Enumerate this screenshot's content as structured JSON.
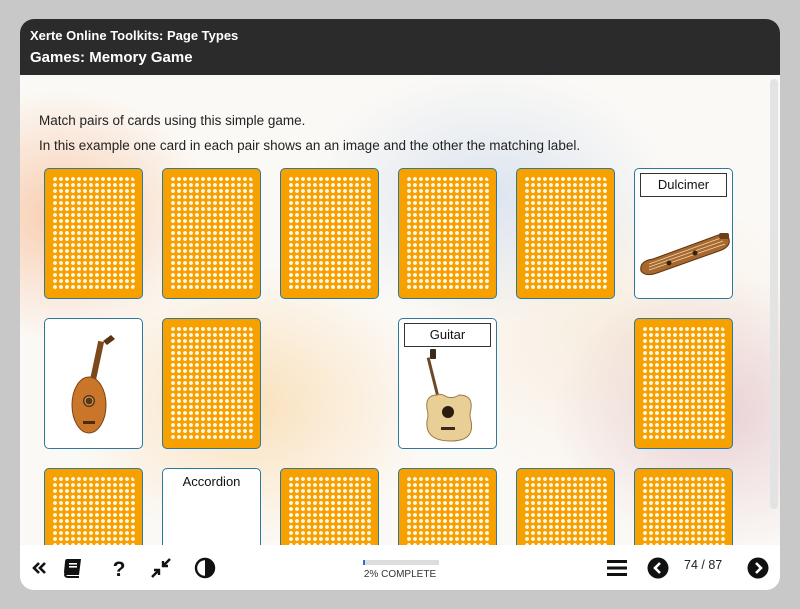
{
  "header": {
    "toolkit_title": "Xerte Online Toolkits: Page Types",
    "page_title": "Games: Memory Game"
  },
  "content": {
    "intro_1": "Match pairs of cards using this simple game.",
    "intro_2": "In this example one card in each pair shows an an image and the other the matching label."
  },
  "cards": {
    "dulcimer_label": "Dulcimer",
    "guitar_label": "Guitar",
    "accordion_label": "Accordion"
  },
  "footer": {
    "progress_text": "2% COMPLETE",
    "progress_percent": 2,
    "page_counter": "74 / 87"
  },
  "icons": {
    "collapse": "double-chevron-left-icon",
    "glossary": "book-icon",
    "help": "question-icon",
    "minimize": "shrink-arrows-icon",
    "contrast": "contrast-icon",
    "menu": "hamburger-icon",
    "prev": "chevron-left-circle-icon",
    "next": "chevron-right-circle-icon"
  },
  "colors": {
    "header_bg": "#2b2b2b",
    "card_back": "#f7a100",
    "card_border": "#2b7a9e",
    "progress": "#2a6fd6"
  }
}
